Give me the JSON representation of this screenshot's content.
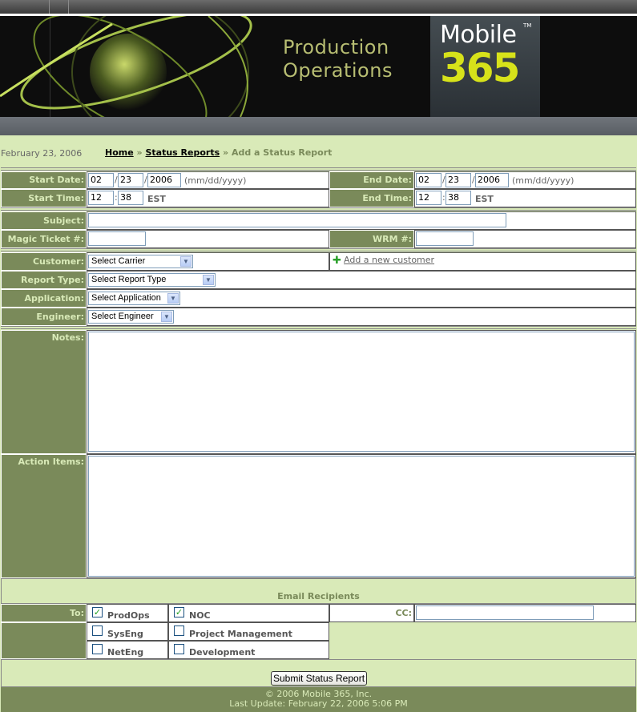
{
  "header": {
    "title_line1": "Production",
    "title_line2": "Operations",
    "logo_top": "Mobile",
    "logo_num": "365",
    "logo_tm": "TM"
  },
  "crumb": {
    "date": "February 23, 2006",
    "home": "Home",
    "sep": "»",
    "reports": "Status Reports",
    "current": "Add a Status Report"
  },
  "form": {
    "start_date_label": "Start Date:",
    "end_date_label": "End Date:",
    "start_time_label": "Start Time:",
    "end_time_label": "End Time:",
    "start_month": "02",
    "start_day": "23",
    "start_year": "2006",
    "end_month": "02",
    "end_day": "23",
    "end_year": "2006",
    "date_sep": "/",
    "date_hint": "(mm/dd/yyyy)",
    "start_hour": "12",
    "start_min": "38",
    "end_hour": "12",
    "end_min": "38",
    "time_sep": ":",
    "tz": "EST",
    "subject_label": "Subject:",
    "magic_label": "Magic Ticket #:",
    "wrm_label": "WRM #:",
    "customer_label": "Customer:",
    "customer_value": "Select Carrier",
    "add_customer": "Add a new customer",
    "report_type_label": "Report Type:",
    "report_type_value": "Select Report Type",
    "application_label": "Application:",
    "application_value": "Select Application",
    "engineer_label": "Engineer:",
    "engineer_value": "Select Engineer",
    "notes_label": "Notes:",
    "action_label": "Action Items:",
    "email_heading": "Email Recipients",
    "to_label": "To:",
    "cc_label": "CC:",
    "recipients": {
      "prodops": "ProdOps",
      "noc": "NOC",
      "syseng": "SysEng",
      "pm": "Project Management",
      "neteng": "NetEng",
      "dev": "Development"
    },
    "checked": {
      "prodops": true,
      "noc": true,
      "syseng": false,
      "pm": false,
      "neteng": false,
      "dev": false
    },
    "submit": "Submit Status Report"
  },
  "footer": {
    "line1": "© 2006 Mobile 365, Inc.",
    "line2": "Last Update: February 22, 2006 5:06 PM"
  },
  "colors": {
    "accent": "#7a8a5a",
    "bg": "#d9eab8",
    "logo_yellow": "#d7e21a"
  }
}
